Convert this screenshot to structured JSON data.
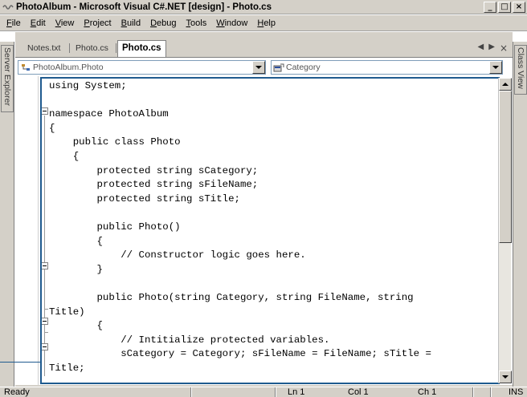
{
  "window": {
    "title": "PhotoAlbum - Microsoft Visual C#.NET [design] - Photo.cs",
    "minimize": "_",
    "maximize": "□",
    "close": "×"
  },
  "menu": {
    "items": [
      {
        "label": "File",
        "key": "F",
        "rest": "ile"
      },
      {
        "label": "Edit",
        "key": "E",
        "rest": "dit"
      },
      {
        "label": "View",
        "key": "V",
        "rest": "iew"
      },
      {
        "label": "Project",
        "key": "P",
        "rest": "roject"
      },
      {
        "label": "Build",
        "key": "B",
        "rest": "uild"
      },
      {
        "label": "Debug",
        "key": "D",
        "rest": "ebug"
      },
      {
        "label": "Tools",
        "key": "T",
        "rest": "ools"
      },
      {
        "label": "Window",
        "key": "W",
        "rest": "indow"
      },
      {
        "label": "Help",
        "key": "H",
        "rest": "elp"
      }
    ]
  },
  "left_panel": {
    "label": "Server Explorer"
  },
  "right_panel": {
    "label": "Class View"
  },
  "tabs": [
    {
      "label": "Notes.txt",
      "active": false
    },
    {
      "label": "Photo.cs",
      "active": false
    },
    {
      "label": "Photo.cs",
      "active": true
    }
  ],
  "tab_nav": {
    "prev": "◀",
    "next": "▶",
    "close": "×"
  },
  "nav": {
    "type_combo": "PhotoAlbum.Photo",
    "member_combo": "Category"
  },
  "code_lines": [
    "using System;",
    "",
    "namespace PhotoAlbum",
    "{",
    "    public class Photo",
    "    {",
    "        protected string sCategory;",
    "        protected string sFileName;",
    "        protected string sTitle;",
    "",
    "        public Photo()",
    "        {",
    "            // Constructor logic goes here.",
    "        }",
    "",
    "        public Photo(string Category, string FileName, string",
    "Title)",
    "        {",
    "            // Intitialize protected variables.",
    "            sCategory = Category; sFileName = FileName; sTitle =",
    "Title;"
  ],
  "status": {
    "ready": "Ready",
    "line": "Ln 1",
    "col": "Col 1",
    "ch": "Ch 1",
    "mode": "INS"
  },
  "colors": {
    "chrome": "#d4d0c8",
    "highlight_frame": "#1f5b8f"
  }
}
